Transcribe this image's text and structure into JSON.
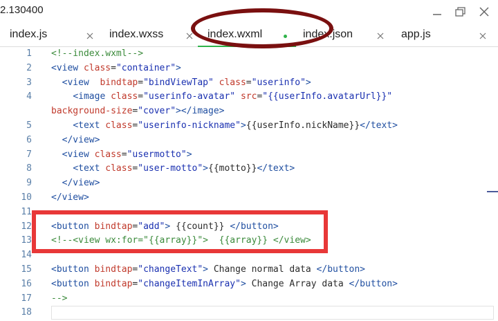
{
  "window": {
    "title": "2.130400",
    "controls": [
      "minimize",
      "restore",
      "close"
    ]
  },
  "tabs": [
    {
      "label": "index.js",
      "active": false,
      "modified": false
    },
    {
      "label": "index.wxss",
      "active": false,
      "modified": false
    },
    {
      "label": "index.wxml",
      "active": true,
      "modified": true
    },
    {
      "label": "index.json",
      "active": false,
      "modified": false
    },
    {
      "label": "app.js",
      "active": false,
      "modified": false
    }
  ],
  "colors": {
    "active_tab_underline": "#2fb34a",
    "modified_dot": "#2fb34a",
    "annotation_ellipse": "#7a1010",
    "annotation_rect": "#e83838"
  },
  "editor": {
    "language": "wxml",
    "lines": [
      {
        "n": "1",
        "tokens": [
          [
            "comment",
            "<!--index.wxml-->"
          ]
        ]
      },
      {
        "n": "2",
        "tokens": [
          [
            "tag",
            "<view "
          ],
          [
            "attr",
            "class"
          ],
          [
            "eq",
            "="
          ],
          [
            "str",
            "\"container\""
          ],
          [
            "tag",
            ">"
          ]
        ]
      },
      {
        "n": "3",
        "tokens": [
          [
            "plain",
            "  "
          ],
          [
            "tag",
            "<view  "
          ],
          [
            "attr",
            "bindtap"
          ],
          [
            "eq",
            "="
          ],
          [
            "str",
            "\"bindViewTap\""
          ],
          [
            "plain",
            " "
          ],
          [
            "attr",
            "class"
          ],
          [
            "eq",
            "="
          ],
          [
            "str",
            "\"userinfo\""
          ],
          [
            "tag",
            ">"
          ]
        ]
      },
      {
        "n": "4",
        "tokens": [
          [
            "plain",
            "    "
          ],
          [
            "tag",
            "<image "
          ],
          [
            "attr",
            "class"
          ],
          [
            "eq",
            "="
          ],
          [
            "str",
            "\"userinfo-avatar\""
          ],
          [
            "plain",
            " "
          ],
          [
            "attr",
            "src"
          ],
          [
            "eq",
            "="
          ],
          [
            "str",
            "\"{{userInfo.avatarUrl}}\""
          ]
        ]
      },
      {
        "n": "",
        "tokens": [
          [
            "attr",
            "background-size"
          ],
          [
            "eq",
            "="
          ],
          [
            "str",
            "\"cover\""
          ],
          [
            "tag",
            "></image>"
          ]
        ]
      },
      {
        "n": "5",
        "tokens": [
          [
            "plain",
            "    "
          ],
          [
            "tag",
            "<text "
          ],
          [
            "attr",
            "class"
          ],
          [
            "eq",
            "="
          ],
          [
            "str",
            "\"userinfo-nickname\""
          ],
          [
            "tag",
            ">"
          ],
          [
            "plain",
            "{{userInfo.nickName}}"
          ],
          [
            "tag",
            "</text>"
          ]
        ]
      },
      {
        "n": "6",
        "tokens": [
          [
            "plain",
            "  "
          ],
          [
            "tag",
            "</view>"
          ]
        ]
      },
      {
        "n": "7",
        "tokens": [
          [
            "plain",
            "  "
          ],
          [
            "tag",
            "<view "
          ],
          [
            "attr",
            "class"
          ],
          [
            "eq",
            "="
          ],
          [
            "str",
            "\"usermotto\""
          ],
          [
            "tag",
            ">"
          ]
        ]
      },
      {
        "n": "8",
        "tokens": [
          [
            "plain",
            "    "
          ],
          [
            "tag",
            "<text "
          ],
          [
            "attr",
            "class"
          ],
          [
            "eq",
            "="
          ],
          [
            "str",
            "\"user-motto\""
          ],
          [
            "tag",
            ">"
          ],
          [
            "plain",
            "{{motto}}"
          ],
          [
            "tag",
            "</text>"
          ]
        ]
      },
      {
        "n": "9",
        "tokens": [
          [
            "plain",
            "  "
          ],
          [
            "tag",
            "</view>"
          ]
        ]
      },
      {
        "n": "10",
        "tokens": [
          [
            "tag",
            "</view>"
          ]
        ]
      },
      {
        "n": "11",
        "tokens": []
      },
      {
        "n": "12",
        "tokens": [
          [
            "tag",
            "<button "
          ],
          [
            "attr",
            "bindtap"
          ],
          [
            "eq",
            "="
          ],
          [
            "str",
            "\"add\""
          ],
          [
            "tag",
            ">"
          ],
          [
            "plain",
            " {{count}} "
          ],
          [
            "tag",
            "</button>"
          ]
        ]
      },
      {
        "n": "13",
        "tokens": [
          [
            "comment",
            "<!--<view wx:for=\"{{array}}\">  {{array}} </view>"
          ]
        ]
      },
      {
        "n": "14",
        "tokens": []
      },
      {
        "n": "15",
        "tokens": [
          [
            "tag",
            "<button "
          ],
          [
            "attr",
            "bindtap"
          ],
          [
            "eq",
            "="
          ],
          [
            "str",
            "\"changeText\""
          ],
          [
            "tag",
            ">"
          ],
          [
            "plain",
            " Change normal data "
          ],
          [
            "tag",
            "</button>"
          ]
        ]
      },
      {
        "n": "16",
        "tokens": [
          [
            "tag",
            "<button "
          ],
          [
            "attr",
            "bindtap"
          ],
          [
            "eq",
            "="
          ],
          [
            "str",
            "\"changeItemInArray\""
          ],
          [
            "tag",
            ">"
          ],
          [
            "plain",
            " Change Array data "
          ],
          [
            "tag",
            "</button>"
          ]
        ]
      },
      {
        "n": "17",
        "tokens": [
          [
            "comment",
            "-->"
          ]
        ]
      },
      {
        "n": "18",
        "tokens": []
      }
    ]
  }
}
